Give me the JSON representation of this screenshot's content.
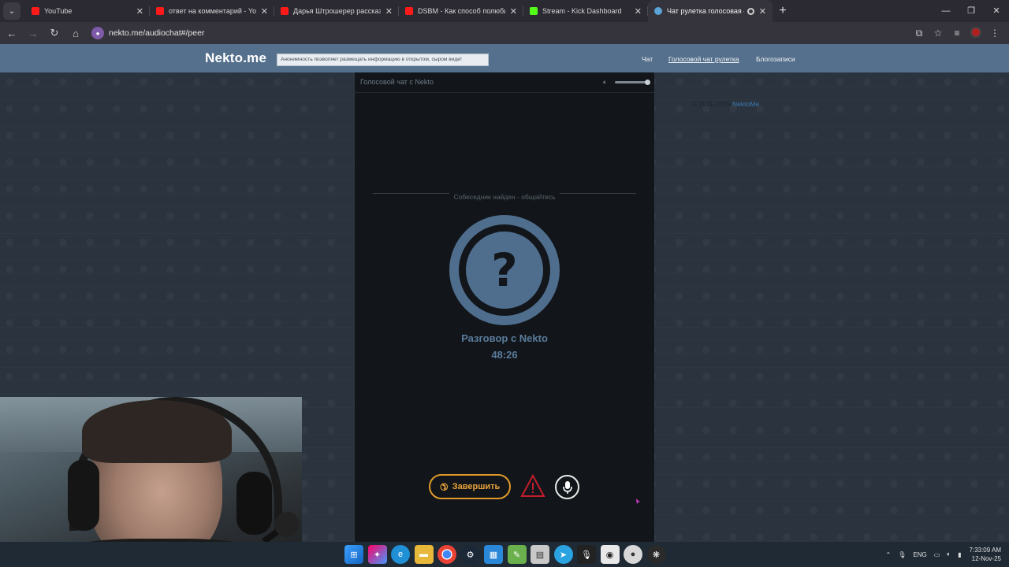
{
  "browser": {
    "tabs": [
      {
        "title": "YouTube",
        "favicon": "youtube-icon",
        "active": false
      },
      {
        "title": "ответ на комментарий - YouTube",
        "favicon": "youtube-icon",
        "active": false
      },
      {
        "title": "Дарья Штрошерер рассказыв",
        "favicon": "youtube-icon",
        "active": false
      },
      {
        "title": "DSBM - Как способ полюбить",
        "favicon": "youtube-icon",
        "active": false
      },
      {
        "title": "Stream - Kick Dashboard",
        "favicon": "kick-icon",
        "active": false
      },
      {
        "title": "Чат рулетка голосовая — N",
        "favicon": "nekto-icon",
        "active": true
      }
    ],
    "url": "nekto.me/audiochat#/peer"
  },
  "site": {
    "logo": "Nekto.me",
    "notice": "Анонимность позволяет размещать информацию в открытом, сыром виде!",
    "nav": {
      "chat": "Чат",
      "voice_roulette": "Голосовой чат рулетка",
      "blog": "Блогозаписи"
    },
    "copyright_prefix": "© 2011-2025",
    "copyright_link": "NektoMe"
  },
  "chat_panel": {
    "title": "Голосовой чат с Nekto",
    "volume_level": 1.0,
    "status": "Собеседник найден - общайтесь",
    "avatar_symbol": "?",
    "conversation_title": "Разговор с Nekto",
    "timer": "48:26",
    "end_button_label": "Завершить"
  },
  "taskbar": {
    "language": "ENG",
    "time": "7:33:09 AM",
    "date": "12-Nov-25"
  },
  "colors": {
    "header": "#55708c",
    "panel_bg": "#12161a",
    "avatar": "#4f6e8e",
    "end_button": "#e19a2a",
    "warning": "#c41c2c"
  }
}
